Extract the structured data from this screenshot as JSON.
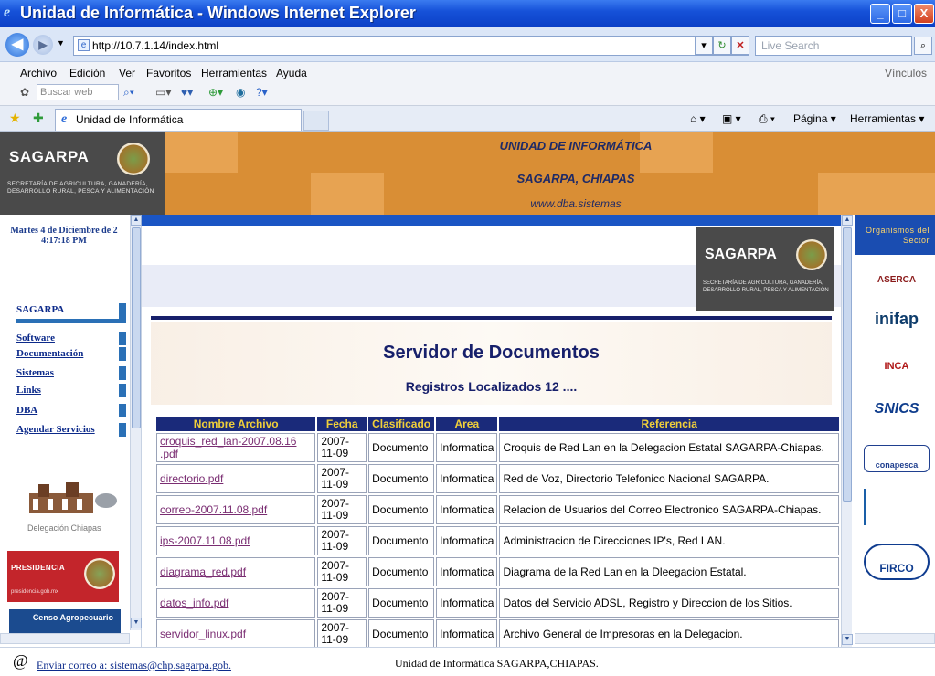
{
  "window": {
    "title": "Unidad de Informática - Windows Internet Explorer",
    "minimize": "_",
    "maximize": "□",
    "close": "X"
  },
  "address": {
    "url": "http://10.7.1.14/index.html",
    "search_placeholder": "Live Search"
  },
  "menu": [
    "Archivo",
    "Edición",
    "Ver",
    "Favoritos",
    "Herramientas",
    "Ayuda"
  ],
  "links_label": "Vínculos",
  "toolbar2": {
    "search_placeholder": "Buscar web"
  },
  "tab": {
    "label": "Unidad de Informática"
  },
  "tools": {
    "page": "Página ▾",
    "tools": "Herramientas ▾"
  },
  "header": {
    "line1": "UNIDAD DE INFORMÁTICA",
    "line2": "SAGARPA, CHIAPAS",
    "line3": "www.dba.sistemas",
    "logo_name": "SAGARPA",
    "logo_sub": "SECRETARÍA DE AGRICULTURA, GANADERÍA, DESARROLLO RURAL, PESCA Y ALIMENTACIÓN"
  },
  "sidebar": {
    "date_line1": "Martes 4 de Diciembre de 2",
    "date_line2": "4:17:18 PM",
    "items": [
      {
        "label": "SAGARPA"
      },
      {
        "label": "Software"
      },
      {
        "label": "Documentación"
      },
      {
        "label": "Sistemas"
      },
      {
        "label": "Links"
      },
      {
        "label": "DBA"
      },
      {
        "label": "Agendar Servicios"
      }
    ],
    "delegacion_caption": "Delegación Chiapas",
    "presidencia": "PRESIDENCIA",
    "presidencia_url": "presidencia.gob.mx",
    "censo": "Censo Agropecuario"
  },
  "main": {
    "title": "Servidor de Documentos",
    "records": "Registros Localizados 12 ....",
    "logo_name": "SAGARPA",
    "logo_sub": "SECRETARÍA DE AGRICULTURA, GANADERÍA, DESARROLLO RURAL, PESCA Y ALIMENTACIÓN",
    "columns": [
      "Nombre Archivo",
      "Fecha",
      "Clasificado",
      "Area",
      "Referencia"
    ],
    "rows": [
      {
        "file": "croquis_red_lan-2007.08.16 .pdf",
        "date": "2007-11-09",
        "class": "Documento",
        "area": "Informatica",
        "ref": "Croquis de Red Lan en la Delegacion Estatal SAGARPA-Chiapas."
      },
      {
        "file": "directorio.pdf",
        "date": "2007-11-09",
        "class": "Documento",
        "area": "Informatica",
        "ref": "Red de Voz, Directorio Telefonico Nacional SAGARPA."
      },
      {
        "file": "correo-2007.11.08.pdf",
        "date": "2007-11-09",
        "class": "Documento",
        "area": "Informatica",
        "ref": "Relacion de Usuarios del Correo Electronico SAGARPA-Chiapas."
      },
      {
        "file": "ips-2007.11.08.pdf",
        "date": "2007-11-09",
        "class": "Documento",
        "area": "Informatica",
        "ref": "Administracion de Direcciones IP's, Red LAN."
      },
      {
        "file": "diagrama_red.pdf",
        "date": "2007-11-09",
        "class": "Documento",
        "area": "Informatica",
        "ref": "Diagrama de la Red Lan en la Dleegacion Estatal."
      },
      {
        "file": "datos_info.pdf",
        "date": "2007-11-09",
        "class": "Documento",
        "area": "Informatica",
        "ref": "Datos del Servicio ADSL, Registro y Direccion de los Sitios."
      },
      {
        "file": "servidor_linux.pdf",
        "date": "2007-11-09",
        "class": "Documento",
        "area": "Informatica",
        "ref": "Archivo General de Impresoras en la Delegacion."
      }
    ]
  },
  "rightside": {
    "title": "Organismos del Sector",
    "orgs": [
      "ASERCA",
      "inifap",
      "INCA",
      "SNICS",
      "conapesca",
      "FIRCO"
    ]
  },
  "status": {
    "mail_link": "Enviar correo a: sistemas@chp.sagarpa.gob.",
    "footer": "Unidad de Informática SAGARPA,CHIAPAS."
  }
}
